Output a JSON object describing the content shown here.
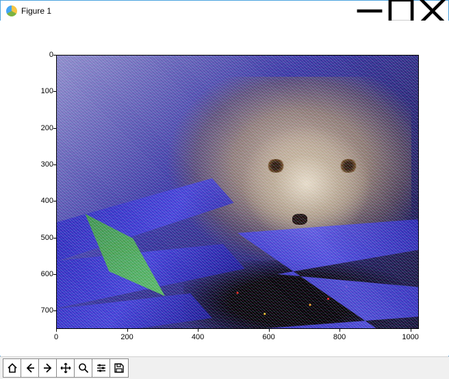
{
  "window": {
    "title": "Figure 1"
  },
  "win_controls": {
    "minimize": "minimize",
    "maximize": "maximize",
    "close": "close"
  },
  "axes": {
    "x_ticks": [
      "0",
      "200",
      "400",
      "600",
      "800",
      "1000"
    ],
    "y_ticks": [
      "0",
      "100",
      "200",
      "300",
      "400",
      "500",
      "600",
      "700"
    ],
    "x_range": [
      0,
      1000
    ],
    "y_range": [
      0,
      750
    ],
    "image_extent": {
      "x": [
        0,
        1024
      ],
      "y": [
        0,
        768
      ]
    }
  },
  "toolbar": {
    "buttons": [
      {
        "name": "home-button",
        "icon": "home-icon"
      },
      {
        "name": "back-button",
        "icon": "arrow-left-icon"
      },
      {
        "name": "forward-button",
        "icon": "arrow-right-icon"
      },
      {
        "name": "pan-button",
        "icon": "move-icon"
      },
      {
        "name": "zoom-button",
        "icon": "magnify-icon"
      },
      {
        "name": "subplots-button",
        "icon": "sliders-icon"
      },
      {
        "name": "save-button",
        "icon": "save-icon"
      }
    ]
  }
}
